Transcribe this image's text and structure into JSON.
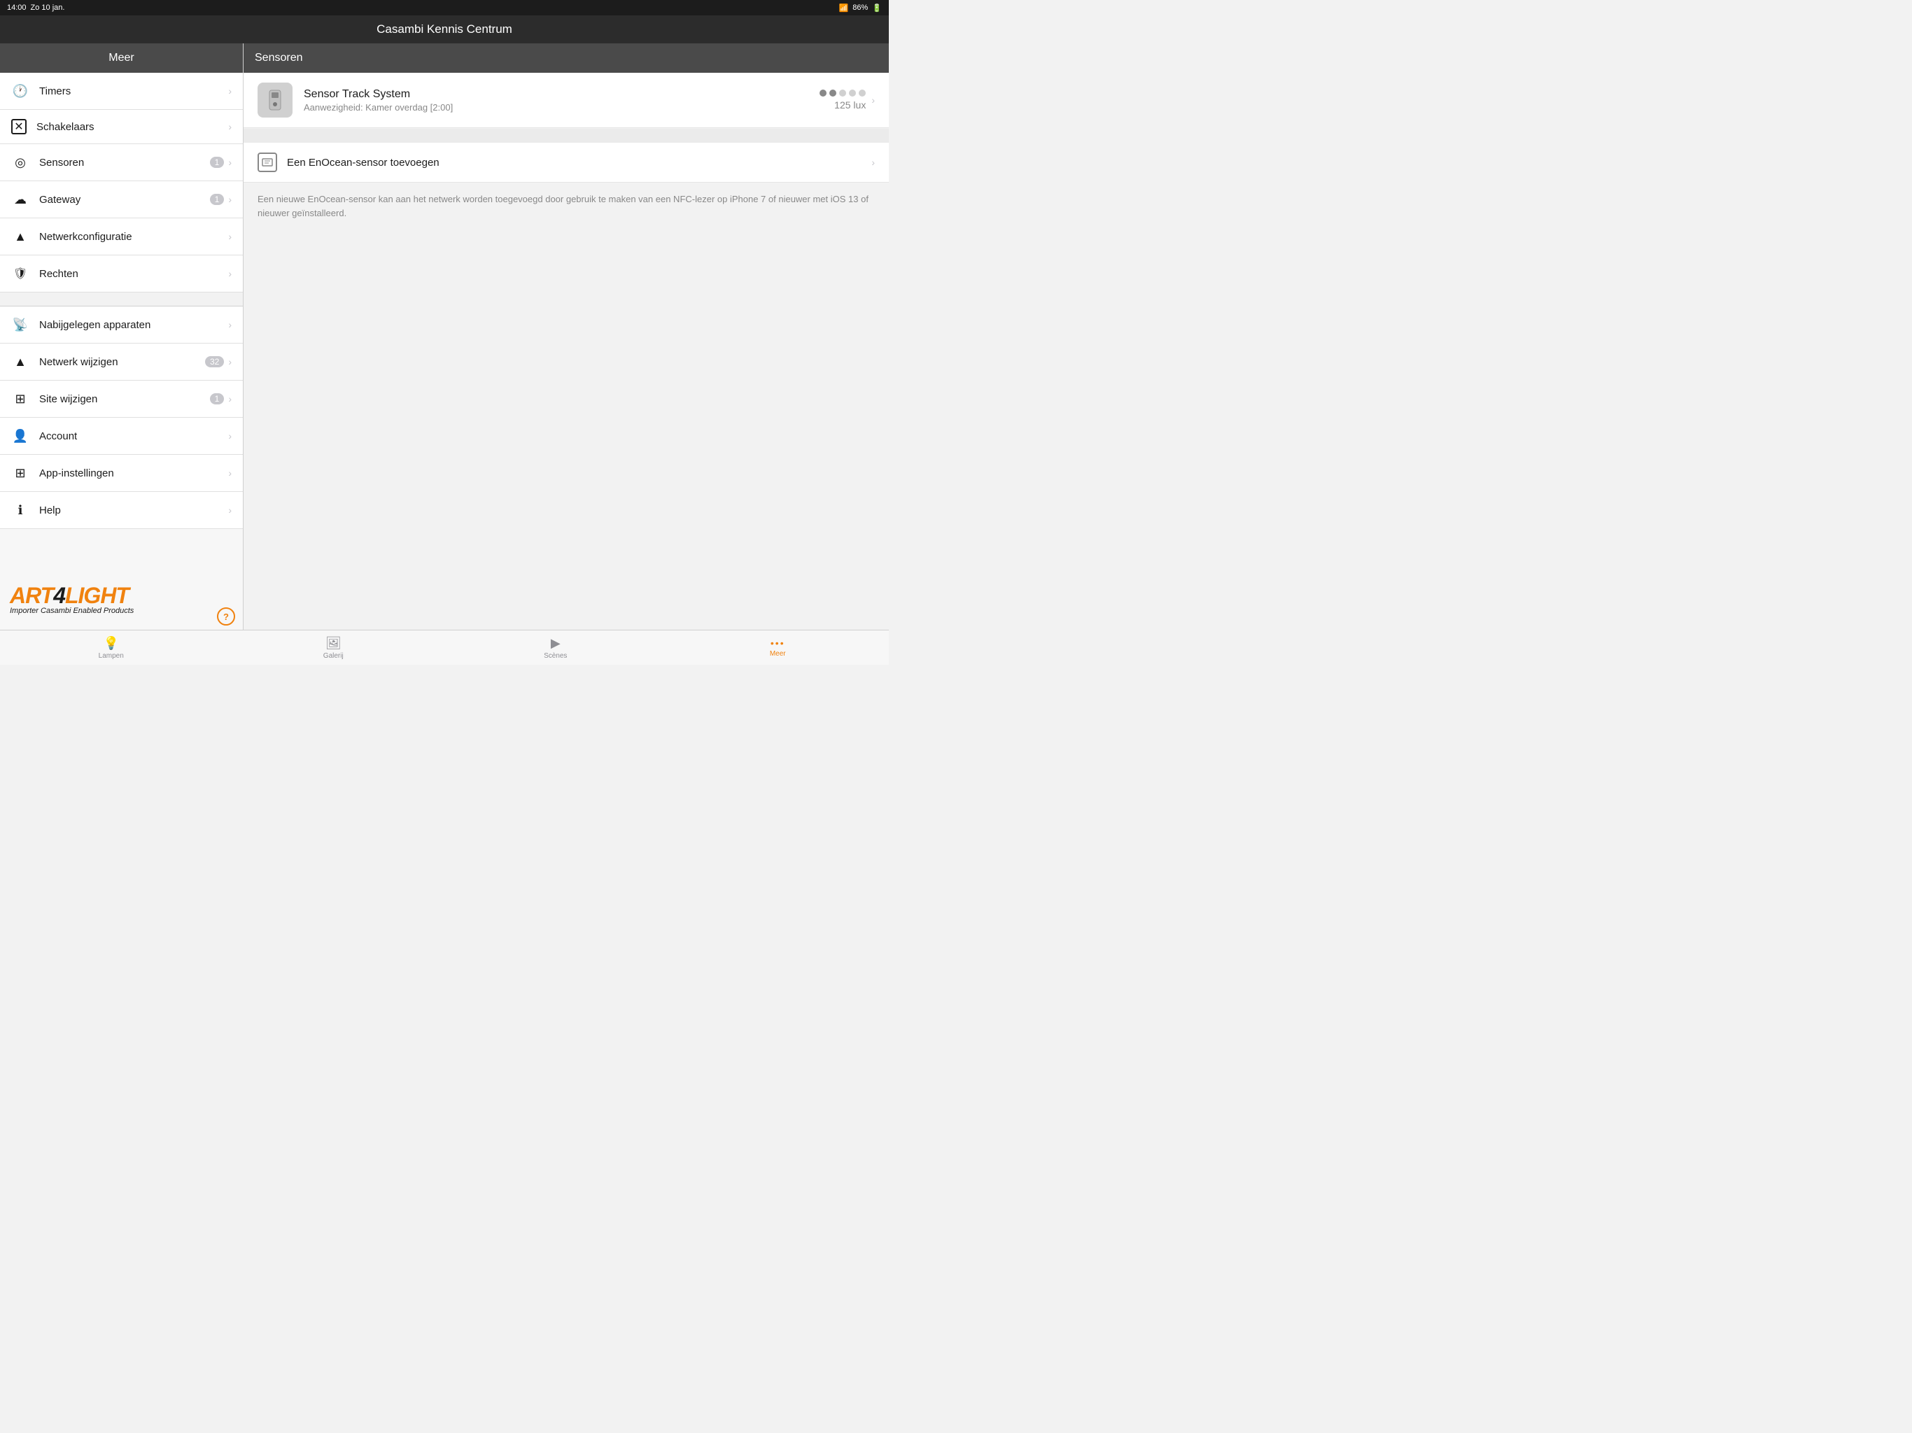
{
  "statusBar": {
    "time": "14:00",
    "day": "Zo 10 jan.",
    "wifi": "wifi-icon",
    "battery": "86%"
  },
  "header": {
    "title": "Casambi Kennis Centrum"
  },
  "sidebar": {
    "header_label": "Meer",
    "items_group1": [
      {
        "id": "timers",
        "icon": "🕐",
        "label": "Timers",
        "badge": "",
        "chevron": "›"
      },
      {
        "id": "schakelaars",
        "icon": "✕",
        "label": "Schakelaars",
        "badge": "",
        "chevron": "›"
      },
      {
        "id": "sensoren",
        "icon": "◎",
        "label": "Sensoren",
        "badge": "1",
        "chevron": "›"
      },
      {
        "id": "gateway",
        "icon": "☁",
        "label": "Gateway",
        "badge": "1",
        "chevron": "›"
      },
      {
        "id": "netwerkconfiguratie",
        "icon": "▲",
        "label": "Netwerkconfiguratie",
        "badge": "",
        "chevron": "›"
      },
      {
        "id": "rechten",
        "icon": "⛨",
        "label": "Rechten",
        "badge": "",
        "chevron": "›"
      }
    ],
    "items_group2": [
      {
        "id": "nabijgelegen",
        "icon": "📡",
        "label": "Nabijgelegen apparaten",
        "badge": "",
        "chevron": "›"
      },
      {
        "id": "netwerk-wijzigen",
        "icon": "▲",
        "label": "Netwerk wijzigen",
        "badge": "32",
        "chevron": "›"
      },
      {
        "id": "site-wijzigen",
        "icon": "⊞",
        "label": "Site wijzigen",
        "badge": "1",
        "chevron": "›"
      },
      {
        "id": "account",
        "icon": "👤",
        "label": "Account",
        "badge": "",
        "chevron": "›"
      },
      {
        "id": "app-instellingen",
        "icon": "⊞",
        "label": "App-instellingen",
        "badge": "",
        "chevron": "›"
      },
      {
        "id": "help",
        "icon": "ℹ",
        "label": "Help",
        "badge": "",
        "chevron": "›"
      }
    ]
  },
  "content": {
    "header_label": "Sensoren",
    "sensor": {
      "name": "Sensor Track System",
      "status": "Aanwezigheid: Kamer overdag [2:00]",
      "dots_active": 2,
      "dots_total": 5,
      "lux": "125 lux"
    },
    "add_sensor": {
      "label": "Een EnOcean-sensor toevoegen",
      "description": "Een nieuwe EnOcean-sensor kan aan het netwerk worden toegevoegd door gebruik te maken van een NFC-lezer op iPhone 7 of nieuwer met iOS 13 of nieuwer geïnstalleerd."
    }
  },
  "tabBar": {
    "items": [
      {
        "id": "lampen",
        "icon": "💡",
        "label": "Lampen",
        "active": false
      },
      {
        "id": "galerij",
        "icon": "🖼",
        "label": "Galerij",
        "active": false
      },
      {
        "id": "scenes",
        "icon": "▶",
        "label": "Scènes",
        "active": false
      },
      {
        "id": "meer",
        "icon": "•••",
        "label": "Meer",
        "active": true
      }
    ]
  },
  "logo": {
    "text": "ART4LIGHT",
    "sub": "Importer Casambi Enabled Products"
  }
}
